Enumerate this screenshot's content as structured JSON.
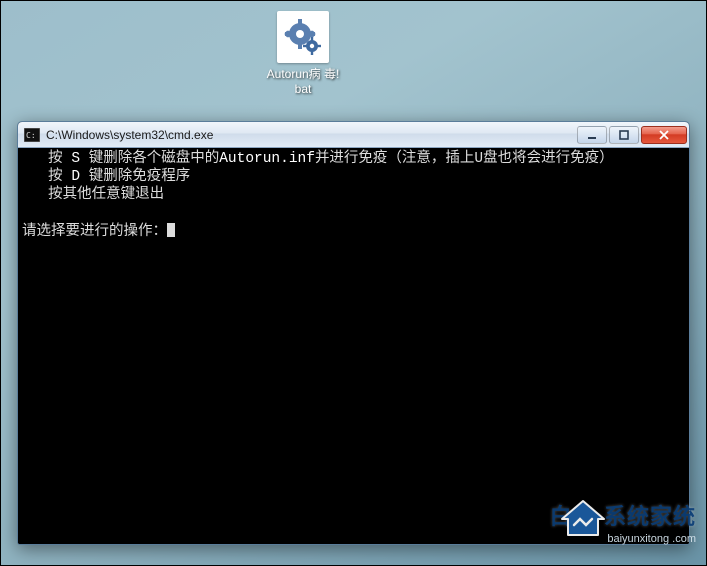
{
  "desktop_icon": {
    "label": "Autorun病\n毒!bat",
    "kind": "batch-file",
    "icon_hint": "gears"
  },
  "cmd_window": {
    "title": "C:\\Windows\\system32\\cmd.exe",
    "lines": {
      "l1_pre": "   按 ",
      "l1_key": "S",
      "l1_mid": " 键删除各个磁盘中的",
      "l1_file": "Autorun.inf",
      "l1_post": "并进行免疫（注意，插上U盘也将会进行免疫）",
      "l2_pre": "   按 ",
      "l2_key": "D",
      "l2_post": " 键删除免疫程序",
      "l3": "   按其他任意键退出",
      "blank": "",
      "prompt": "请选择要进行的操作："
    },
    "controls": {
      "minimize": "minimize",
      "maximize": "maximize",
      "close": "close"
    }
  },
  "watermark": {
    "brand": "白二·系统家统",
    "url": "baiyunxitong .com"
  }
}
